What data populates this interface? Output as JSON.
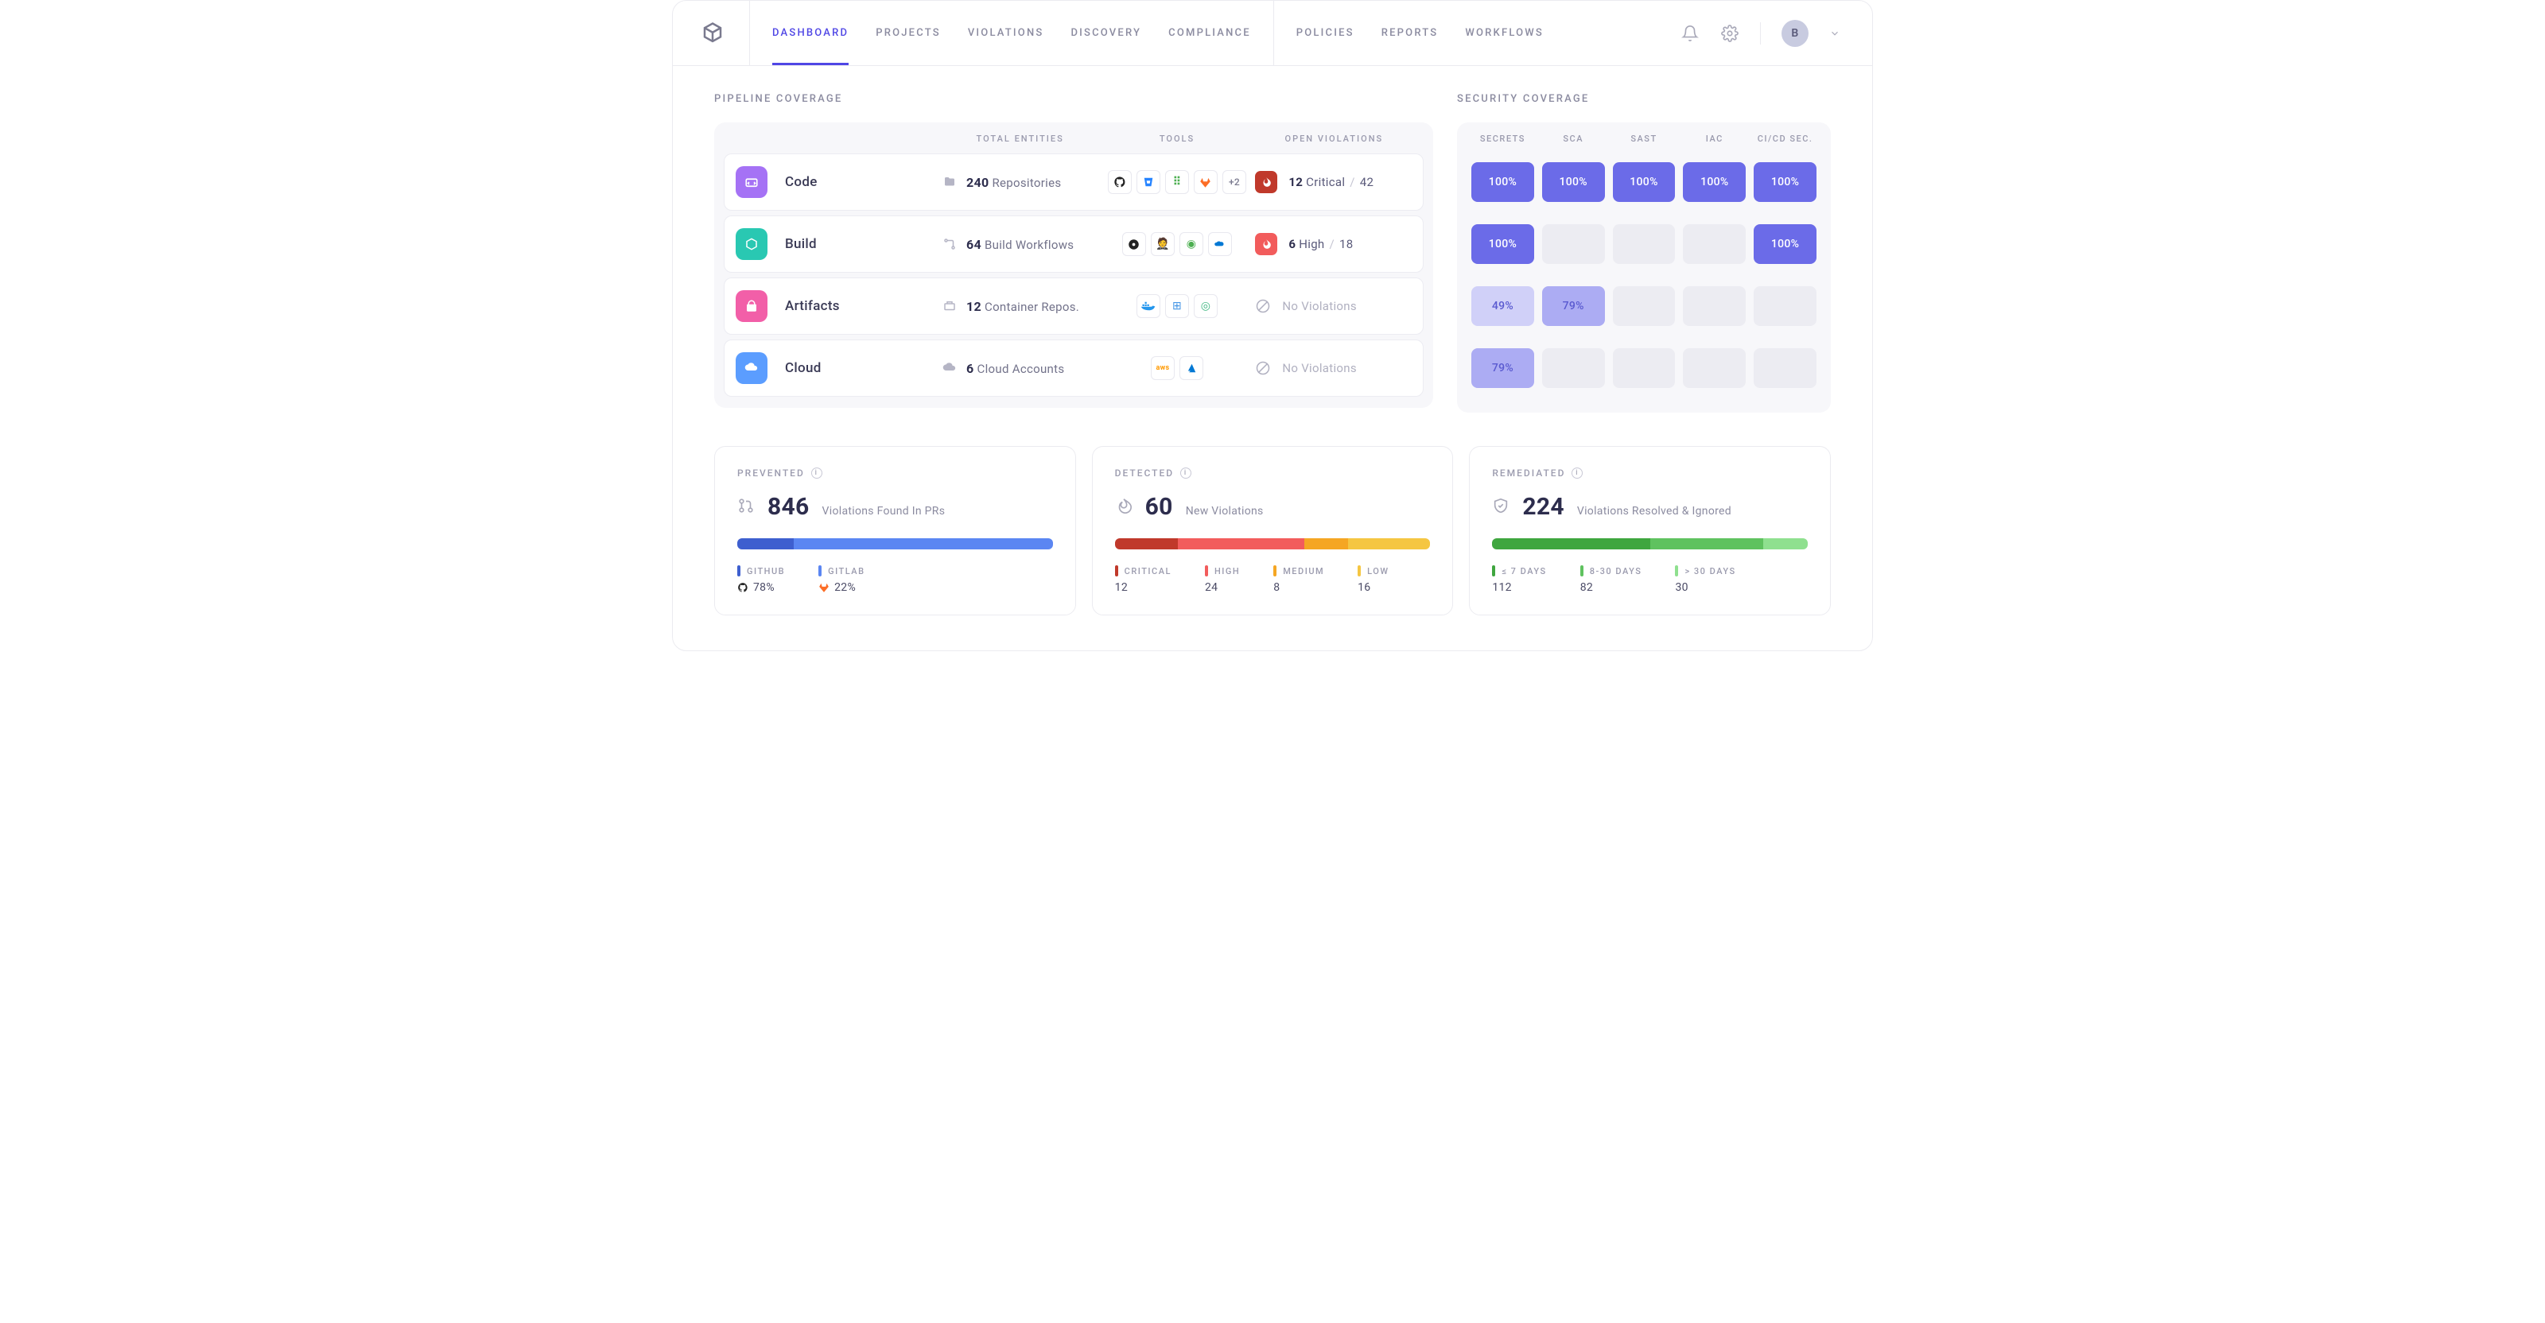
{
  "nav": {
    "tabs": [
      "DASHBOARD",
      "PROJECTS",
      "VIOLATIONS",
      "DISCOVERY",
      "COMPLIANCE"
    ],
    "tabs2": [
      "POLICIES",
      "REPORTS",
      "WORKFLOWS"
    ],
    "avatar": "B"
  },
  "pipeline": {
    "title": "PIPELINE COVERAGE",
    "headers": [
      "TOTAL ENTITIES",
      "TOOLS",
      "OPEN VIOLATIONS"
    ],
    "rows": [
      {
        "name": "Code",
        "count": "240",
        "unit": "Repositories",
        "tools": 5,
        "more": "+2",
        "viol": {
          "type": "critical",
          "n": "12",
          "label": "Critical",
          "total": "42"
        }
      },
      {
        "name": "Build",
        "count": "64",
        "unit": "Build Workflows",
        "tools": 4,
        "viol": {
          "type": "high",
          "n": "6",
          "label": "High",
          "total": "18"
        }
      },
      {
        "name": "Artifacts",
        "count": "12",
        "unit": "Container Repos.",
        "tools": 3,
        "viol": {
          "type": "none",
          "label": "No Violations"
        }
      },
      {
        "name": "Cloud",
        "count": "6",
        "unit": "Cloud Accounts",
        "tools": 2,
        "viol": {
          "type": "none",
          "label": "No Violations"
        }
      }
    ]
  },
  "security": {
    "title": "SECURITY COVERAGE",
    "headers": [
      "SECRETS",
      "SCA",
      "SAST",
      "IAC",
      "CI/CD SEC."
    ],
    "grid": [
      [
        {
          "v": "100%",
          "c": "full"
        },
        {
          "v": "100%",
          "c": "full"
        },
        {
          "v": "100%",
          "c": "full"
        },
        {
          "v": "100%",
          "c": "full"
        },
        {
          "v": "100%",
          "c": "full"
        }
      ],
      [
        {
          "v": "100%",
          "c": "full"
        },
        {
          "v": "",
          "c": "empty"
        },
        {
          "v": "",
          "c": "empty"
        },
        {
          "v": "",
          "c": "empty"
        },
        {
          "v": "100%",
          "c": "full"
        }
      ],
      [
        {
          "v": "49%",
          "c": "p49"
        },
        {
          "v": "79%",
          "c": "p79"
        },
        {
          "v": "",
          "c": "empty"
        },
        {
          "v": "",
          "c": "empty"
        },
        {
          "v": "",
          "c": "empty"
        }
      ],
      [
        {
          "v": "79%",
          "c": "p79"
        },
        {
          "v": "",
          "c": "empty"
        },
        {
          "v": "",
          "c": "empty"
        },
        {
          "v": "",
          "c": "empty"
        },
        {
          "v": "",
          "c": "empty"
        }
      ]
    ]
  },
  "cards": {
    "prevented": {
      "title": "PREVENTED",
      "big": "846",
      "sub": "Violations Found In PRs",
      "segs": [
        {
          "w": 18,
          "c": "#3e5fcf"
        },
        {
          "w": 82,
          "c": "#5b86f2"
        }
      ],
      "legend": [
        {
          "pip": "#3e5fcf",
          "label": "GITHUB",
          "val": "78%",
          "ico": "gh"
        },
        {
          "pip": "#5b86f2",
          "label": "GITLAB",
          "val": "22%",
          "ico": "gl"
        }
      ]
    },
    "detected": {
      "title": "DETECTED",
      "big": "60",
      "sub": "New Violations",
      "segs": [
        {
          "w": 20,
          "c": "#c0392b"
        },
        {
          "w": 40,
          "c": "#f25c5c"
        },
        {
          "w": 14,
          "c": "#f5a623"
        },
        {
          "w": 26,
          "c": "#f5c642"
        }
      ],
      "legend": [
        {
          "pip": "#c0392b",
          "label": "CRITICAL",
          "val": "12"
        },
        {
          "pip": "#f25c5c",
          "label": "HIGH",
          "val": "24"
        },
        {
          "pip": "#f5a623",
          "label": "MEDIUM",
          "val": "8"
        },
        {
          "pip": "#f5c642",
          "label": "LOW",
          "val": "16"
        }
      ]
    },
    "remediated": {
      "title": "REMEDIATED",
      "big": "224",
      "sub": "Violations Resolved & Ignored",
      "segs": [
        {
          "w": 50,
          "c": "#3fa63f"
        },
        {
          "w": 36,
          "c": "#5fc25f"
        },
        {
          "w": 14,
          "c": "#8fe08f"
        }
      ],
      "legend": [
        {
          "pip": "#3fa63f",
          "label": "≤ 7 DAYS",
          "val": "112"
        },
        {
          "pip": "#5fc25f",
          "label": "8-30 DAYS",
          "val": "82"
        },
        {
          "pip": "#8fe08f",
          "label": "> 30 DAYS",
          "val": "30"
        }
      ]
    }
  },
  "chart_data": {
    "prevented_bar": {
      "type": "bar",
      "title": "Prevented violations by source",
      "categories": [
        "GitHub",
        "GitLab"
      ],
      "values": [
        78,
        22
      ],
      "ylabel": "%"
    },
    "detected_bar": {
      "type": "bar",
      "title": "Detected new violations by severity",
      "categories": [
        "Critical",
        "High",
        "Medium",
        "Low"
      ],
      "values": [
        12,
        24,
        8,
        16
      ]
    },
    "remediated_bar": {
      "type": "bar",
      "title": "Remediated violations by age",
      "categories": [
        "≤7 days",
        "8-30 days",
        ">30 days"
      ],
      "values": [
        112,
        82,
        30
      ]
    }
  }
}
